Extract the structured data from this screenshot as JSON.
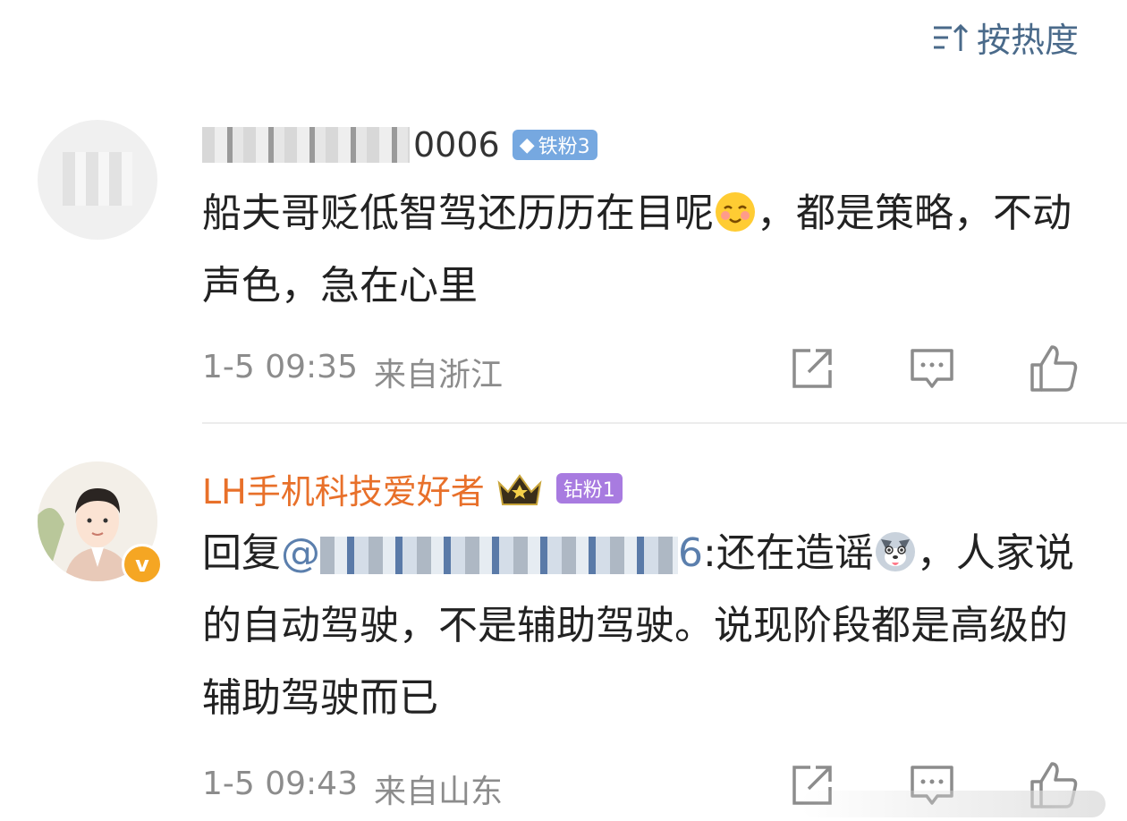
{
  "sort": {
    "label": "按热度"
  },
  "comments": [
    {
      "username_visible": "0006",
      "badge": "铁粉3",
      "text_line1": "船夫哥贬低智驾还历历在目呢",
      "text_after_emoji": "，都是策略，不动声色，急在心里",
      "time": "1-5 09:35",
      "location": "来自浙江"
    },
    {
      "username": "LH手机科技爱好者",
      "badge": "钻粉1",
      "reply_prefix": "回复",
      "mention_visible": "@",
      "mention_tail": "6",
      "reply_text_before_emoji": ":还在造谣",
      "reply_text_after_emoji": "，人家说的自动驾驶，不是辅助驾驶。说现阶段都是高级的辅助驾驶而已",
      "time": "1-5 09:43",
      "location": "来自山东",
      "verified_label": "v"
    }
  ],
  "colors": {
    "username_orange": "#e8702a",
    "mention_blue": "#5b7fad",
    "meta_gray": "#8c8c8c"
  }
}
